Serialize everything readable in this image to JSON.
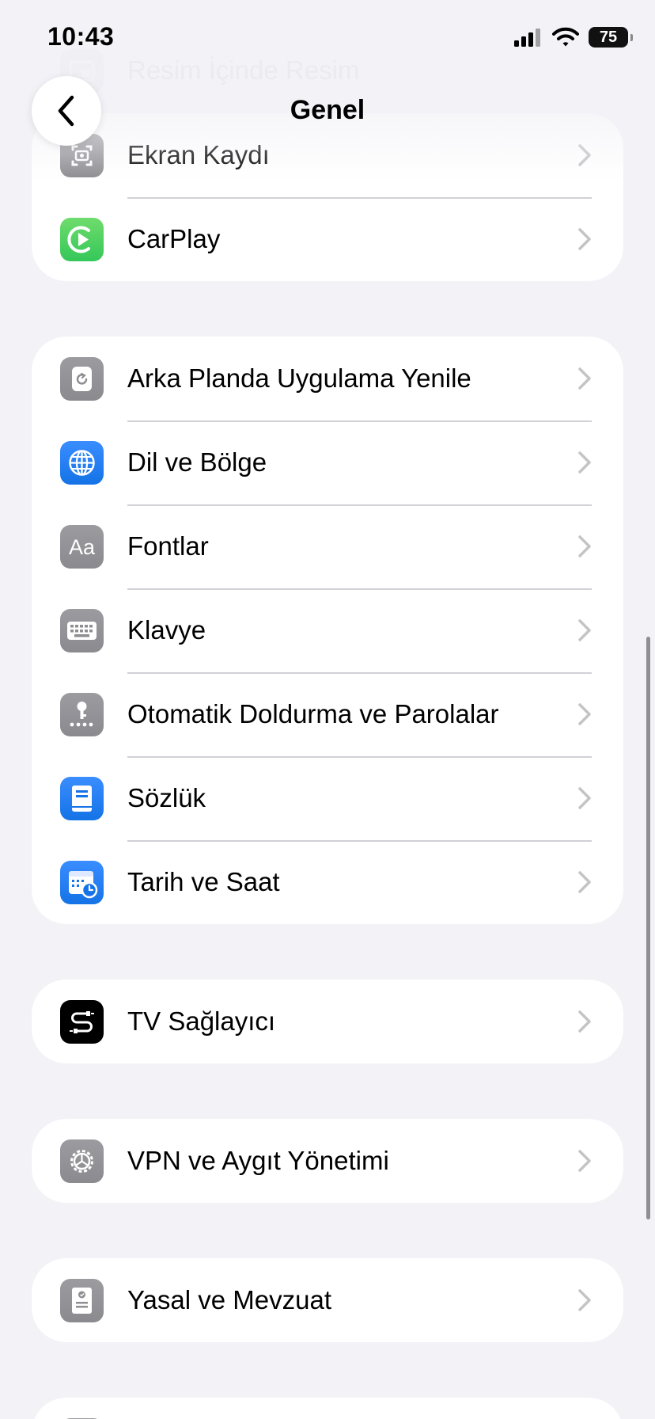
{
  "status": {
    "time": "10:43",
    "battery": "75"
  },
  "nav": {
    "title": "Genel",
    "back_icon": "chevron-left-icon"
  },
  "faded": {
    "pip_label": "Resim İçinde Resim"
  },
  "group1": {
    "items": [
      {
        "label": "Ekran Kaydı",
        "icon": "screen-record-icon"
      },
      {
        "label": "CarPlay",
        "icon": "carplay-icon"
      }
    ]
  },
  "group2": {
    "items": [
      {
        "label": "Arka Planda Uygulama Yenile",
        "icon": "background-refresh-icon"
      },
      {
        "label": "Dil ve Bölge",
        "icon": "globe-icon"
      },
      {
        "label": "Fontlar",
        "icon": "fonts-icon"
      },
      {
        "label": "Klavye",
        "icon": "keyboard-icon"
      },
      {
        "label": "Otomatik Doldurma ve Parolalar",
        "icon": "key-icon"
      },
      {
        "label": "Sözlük",
        "icon": "dictionary-icon"
      },
      {
        "label": "Tarih ve Saat",
        "icon": "calendar-clock-icon"
      }
    ]
  },
  "group3": {
    "items": [
      {
        "label": "TV Sağlayıcı",
        "icon": "tv-provider-icon"
      }
    ]
  },
  "group4": {
    "items": [
      {
        "label": "VPN ve Aygıt Yönetimi",
        "icon": "gear-icon"
      }
    ]
  },
  "group5": {
    "items": [
      {
        "label": "Yasal ve Mevzuat",
        "icon": "legal-document-icon"
      }
    ]
  },
  "colors": {
    "background": "#f2f2f7",
    "cell": "#ffffff",
    "separator": "#d1d1d6",
    "chevron": "#c4c4c7",
    "green": "#34c759",
    "blue": "#1473e6",
    "gray": "#8e8e93"
  }
}
